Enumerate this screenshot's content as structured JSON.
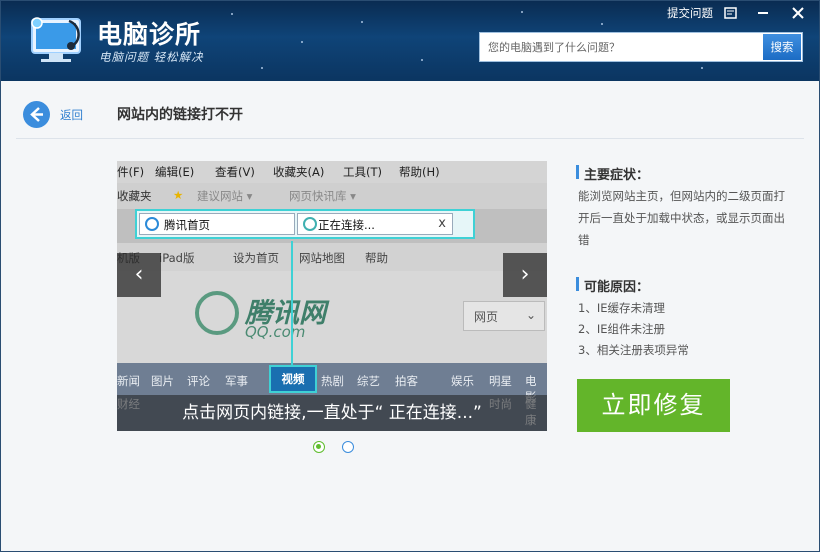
{
  "app": {
    "title": "电脑诊所",
    "slogan": "电脑问题 轻松解决"
  },
  "header": {
    "feedback_label": "提交问题",
    "search": {
      "placeholder": "您的电脑遇到了什么问题？",
      "button_label": "搜索"
    }
  },
  "nav": {
    "back_label": "返回",
    "page_title": "网站内的链接打不开"
  },
  "screenshot": {
    "menu_items": [
      "件(F)",
      "编辑(E)",
      "查看(V)",
      "收藏夹(A)",
      "工具(T)",
      "帮助(H)"
    ],
    "fav_items": [
      "收藏夹",
      "建议网站 ▾",
      "网页快讯库 ▾"
    ],
    "tab1_label": "腾讯首页",
    "tab2_label": "正在连接...",
    "tab_close": "x",
    "link_items": [
      "机版",
      "iPad版",
      "设为首页",
      "网站地图",
      "帮助"
    ],
    "site_logo": "腾讯网",
    "site_logo_sub": "QQ.com",
    "search_select": "网页",
    "categories_row1": [
      "新闻",
      "图片",
      "评论",
      "军事",
      "热剧",
      "综艺",
      "拍客",
      "娱乐",
      "明星",
      "电影"
    ],
    "categories_row2": [
      "财经",
      "时尚",
      "健康"
    ],
    "highlight_category": "视频",
    "caption": "点击网页内链接,一直处于“ 正在连接...”",
    "prev_arrow": "‹",
    "next_arrow": "›"
  },
  "carousel": {
    "active_index": 0,
    "count": 2
  },
  "info": {
    "symptom_title": "主要症状：",
    "symptom_text": "能浏览网站主页，但网站内的二级页面打开后一直处于加载中状态，或显示页面出错",
    "cause_title": "可能原因：",
    "causes": [
      "1、IE缓存未清理",
      "2、IE组件未注册",
      "3、相关注册表项异常"
    ],
    "fix_button": "立即修复"
  },
  "colors": {
    "header_bg": "#0f4478",
    "accent_blue": "#3b8ddd",
    "fix_green": "#63b52a",
    "highlight_cyan": "#3fd1d5"
  }
}
